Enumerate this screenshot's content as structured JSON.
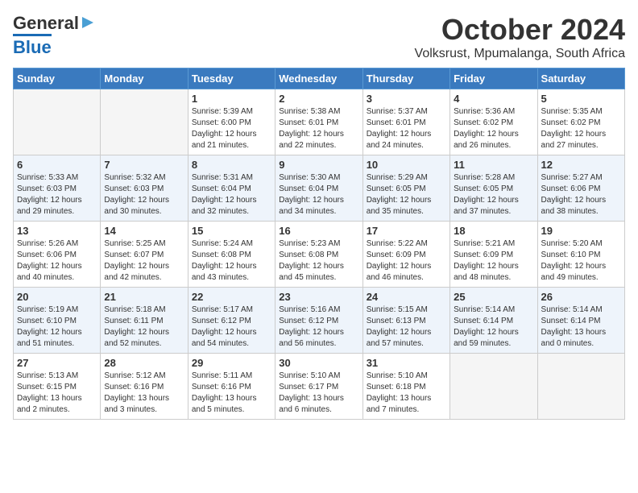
{
  "header": {
    "logo_general": "General",
    "logo_blue": "Blue",
    "month": "October 2024",
    "location": "Volksrust, Mpumalanga, South Africa"
  },
  "days_of_week": [
    "Sunday",
    "Monday",
    "Tuesday",
    "Wednesday",
    "Thursday",
    "Friday",
    "Saturday"
  ],
  "weeks": [
    [
      {
        "day": "",
        "empty": true
      },
      {
        "day": "",
        "empty": true
      },
      {
        "day": "1",
        "sunrise": "Sunrise: 5:39 AM",
        "sunset": "Sunset: 6:00 PM",
        "daylight": "Daylight: 12 hours and 21 minutes."
      },
      {
        "day": "2",
        "sunrise": "Sunrise: 5:38 AM",
        "sunset": "Sunset: 6:01 PM",
        "daylight": "Daylight: 12 hours and 22 minutes."
      },
      {
        "day": "3",
        "sunrise": "Sunrise: 5:37 AM",
        "sunset": "Sunset: 6:01 PM",
        "daylight": "Daylight: 12 hours and 24 minutes."
      },
      {
        "day": "4",
        "sunrise": "Sunrise: 5:36 AM",
        "sunset": "Sunset: 6:02 PM",
        "daylight": "Daylight: 12 hours and 26 minutes."
      },
      {
        "day": "5",
        "sunrise": "Sunrise: 5:35 AM",
        "sunset": "Sunset: 6:02 PM",
        "daylight": "Daylight: 12 hours and 27 minutes."
      }
    ],
    [
      {
        "day": "6",
        "sunrise": "Sunrise: 5:33 AM",
        "sunset": "Sunset: 6:03 PM",
        "daylight": "Daylight: 12 hours and 29 minutes."
      },
      {
        "day": "7",
        "sunrise": "Sunrise: 5:32 AM",
        "sunset": "Sunset: 6:03 PM",
        "daylight": "Daylight: 12 hours and 30 minutes."
      },
      {
        "day": "8",
        "sunrise": "Sunrise: 5:31 AM",
        "sunset": "Sunset: 6:04 PM",
        "daylight": "Daylight: 12 hours and 32 minutes."
      },
      {
        "day": "9",
        "sunrise": "Sunrise: 5:30 AM",
        "sunset": "Sunset: 6:04 PM",
        "daylight": "Daylight: 12 hours and 34 minutes."
      },
      {
        "day": "10",
        "sunrise": "Sunrise: 5:29 AM",
        "sunset": "Sunset: 6:05 PM",
        "daylight": "Daylight: 12 hours and 35 minutes."
      },
      {
        "day": "11",
        "sunrise": "Sunrise: 5:28 AM",
        "sunset": "Sunset: 6:05 PM",
        "daylight": "Daylight: 12 hours and 37 minutes."
      },
      {
        "day": "12",
        "sunrise": "Sunrise: 5:27 AM",
        "sunset": "Sunset: 6:06 PM",
        "daylight": "Daylight: 12 hours and 38 minutes."
      }
    ],
    [
      {
        "day": "13",
        "sunrise": "Sunrise: 5:26 AM",
        "sunset": "Sunset: 6:06 PM",
        "daylight": "Daylight: 12 hours and 40 minutes."
      },
      {
        "day": "14",
        "sunrise": "Sunrise: 5:25 AM",
        "sunset": "Sunset: 6:07 PM",
        "daylight": "Daylight: 12 hours and 42 minutes."
      },
      {
        "day": "15",
        "sunrise": "Sunrise: 5:24 AM",
        "sunset": "Sunset: 6:08 PM",
        "daylight": "Daylight: 12 hours and 43 minutes."
      },
      {
        "day": "16",
        "sunrise": "Sunrise: 5:23 AM",
        "sunset": "Sunset: 6:08 PM",
        "daylight": "Daylight: 12 hours and 45 minutes."
      },
      {
        "day": "17",
        "sunrise": "Sunrise: 5:22 AM",
        "sunset": "Sunset: 6:09 PM",
        "daylight": "Daylight: 12 hours and 46 minutes."
      },
      {
        "day": "18",
        "sunrise": "Sunrise: 5:21 AM",
        "sunset": "Sunset: 6:09 PM",
        "daylight": "Daylight: 12 hours and 48 minutes."
      },
      {
        "day": "19",
        "sunrise": "Sunrise: 5:20 AM",
        "sunset": "Sunset: 6:10 PM",
        "daylight": "Daylight: 12 hours and 49 minutes."
      }
    ],
    [
      {
        "day": "20",
        "sunrise": "Sunrise: 5:19 AM",
        "sunset": "Sunset: 6:10 PM",
        "daylight": "Daylight: 12 hours and 51 minutes."
      },
      {
        "day": "21",
        "sunrise": "Sunrise: 5:18 AM",
        "sunset": "Sunset: 6:11 PM",
        "daylight": "Daylight: 12 hours and 52 minutes."
      },
      {
        "day": "22",
        "sunrise": "Sunrise: 5:17 AM",
        "sunset": "Sunset: 6:12 PM",
        "daylight": "Daylight: 12 hours and 54 minutes."
      },
      {
        "day": "23",
        "sunrise": "Sunrise: 5:16 AM",
        "sunset": "Sunset: 6:12 PM",
        "daylight": "Daylight: 12 hours and 56 minutes."
      },
      {
        "day": "24",
        "sunrise": "Sunrise: 5:15 AM",
        "sunset": "Sunset: 6:13 PM",
        "daylight": "Daylight: 12 hours and 57 minutes."
      },
      {
        "day": "25",
        "sunrise": "Sunrise: 5:14 AM",
        "sunset": "Sunset: 6:14 PM",
        "daylight": "Daylight: 12 hours and 59 minutes."
      },
      {
        "day": "26",
        "sunrise": "Sunrise: 5:14 AM",
        "sunset": "Sunset: 6:14 PM",
        "daylight": "Daylight: 13 hours and 0 minutes."
      }
    ],
    [
      {
        "day": "27",
        "sunrise": "Sunrise: 5:13 AM",
        "sunset": "Sunset: 6:15 PM",
        "daylight": "Daylight: 13 hours and 2 minutes."
      },
      {
        "day": "28",
        "sunrise": "Sunrise: 5:12 AM",
        "sunset": "Sunset: 6:16 PM",
        "daylight": "Daylight: 13 hours and 3 minutes."
      },
      {
        "day": "29",
        "sunrise": "Sunrise: 5:11 AM",
        "sunset": "Sunset: 6:16 PM",
        "daylight": "Daylight: 13 hours and 5 minutes."
      },
      {
        "day": "30",
        "sunrise": "Sunrise: 5:10 AM",
        "sunset": "Sunset: 6:17 PM",
        "daylight": "Daylight: 13 hours and 6 minutes."
      },
      {
        "day": "31",
        "sunrise": "Sunrise: 5:10 AM",
        "sunset": "Sunset: 6:18 PM",
        "daylight": "Daylight: 13 hours and 7 minutes."
      },
      {
        "day": "",
        "empty": true
      },
      {
        "day": "",
        "empty": true
      }
    ]
  ]
}
